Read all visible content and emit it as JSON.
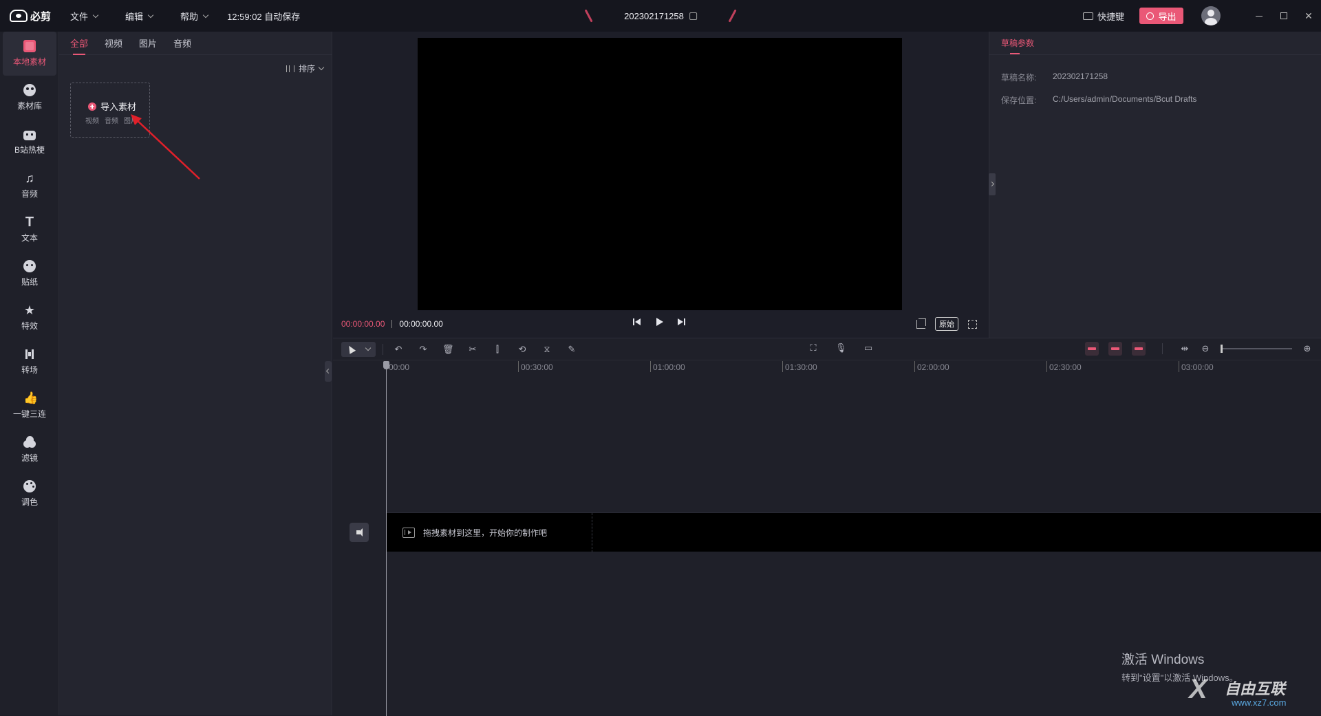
{
  "app": {
    "name": "必剪",
    "menus": [
      "文件",
      "编辑",
      "帮助"
    ],
    "autosave": "12:59:02 自动保存",
    "project_title": "202302171258",
    "shortcut_label": "快捷键",
    "export_label": "导出",
    "accent_color": "#ea5877"
  },
  "leftnav": {
    "items": [
      {
        "label": "本地素材",
        "icon": "folder-icon"
      },
      {
        "label": "素材库",
        "icon": "library-icon"
      },
      {
        "label": "B站热梗",
        "icon": "bilibili-tv-icon"
      },
      {
        "label": "音频",
        "icon": "music-note-icon"
      },
      {
        "label": "文本",
        "icon": "text-icon"
      },
      {
        "label": "贴纸",
        "icon": "sticker-icon"
      },
      {
        "label": "特效",
        "icon": "effects-star-icon"
      },
      {
        "label": "转场",
        "icon": "transition-icon"
      },
      {
        "label": "一键三连",
        "icon": "thumbs-up-icon"
      },
      {
        "label": "滤镜",
        "icon": "filter-icon"
      },
      {
        "label": "调色",
        "icon": "palette-icon"
      }
    ]
  },
  "media": {
    "tabs": [
      "全部",
      "视频",
      "图片",
      "音频"
    ],
    "sort_label": "排序",
    "import_title": "导入素材",
    "import_types": [
      "视频",
      "音频",
      "图片"
    ]
  },
  "preview": {
    "current_time": "00:00:00.00",
    "total_time": "00:00:00.00",
    "ratio_label": "原始"
  },
  "properties": {
    "tab": "草稿参数",
    "name_label": "草稿名称:",
    "name_value": "202302171258",
    "path_label": "保存位置:",
    "path_value": "C:/Users/admin/Documents/Bcut Drafts"
  },
  "timeline": {
    "ruler": [
      "00:00",
      "00:30:00",
      "01:00:00",
      "01:30:00",
      "02:00:00",
      "02:30:00",
      "03:00:00"
    ],
    "drop_hint": "拖拽素材到这里，开始你的制作吧"
  },
  "overlay": {
    "activate_title": "激活 Windows",
    "activate_sub": "转到\"设置\"以激活 Windows。",
    "watermark_text": "自由互联",
    "watermark_url": "www.xz7.com"
  }
}
